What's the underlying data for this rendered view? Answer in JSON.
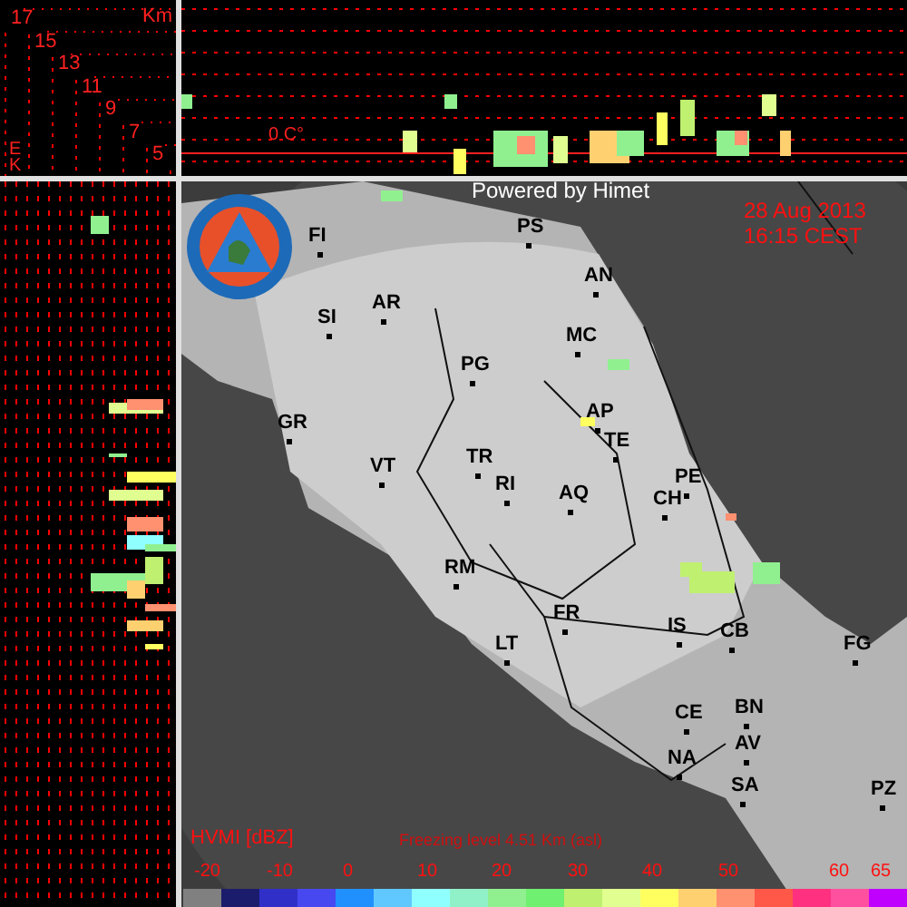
{
  "altitude_axis": {
    "unit": "Km",
    "labels": [
      "17",
      "15",
      "13",
      "11",
      "9",
      "7",
      "5"
    ],
    "corner_letters": [
      "E",
      "K"
    ]
  },
  "vertical_section": {
    "freezing_marker": "0 C°"
  },
  "map": {
    "credit": "Powered by Himet",
    "date": "28 Aug 2013",
    "time": "16:15 CEST",
    "cities": [
      "FI",
      "PS",
      "AN",
      "SI",
      "AR",
      "MC",
      "PG",
      "AP",
      "GR",
      "TE",
      "TR",
      "VT",
      "RI",
      "PE",
      "AQ",
      "CH",
      "RM",
      "FR",
      "IS",
      "CB",
      "LT",
      "FG",
      "CE",
      "BN",
      "AV",
      "NA",
      "SA",
      "PZ"
    ]
  },
  "legend": {
    "title": "HVMI [dBZ]",
    "freezing_level": "Freezing level  4.51 Km (asl)",
    "ticks": [
      "-20",
      "-10",
      "0",
      "10",
      "20",
      "30",
      "40",
      "50",
      "60",
      "65"
    ],
    "color_scale": [
      {
        "color": "#808080"
      },
      {
        "color": "#1c1c6c"
      },
      {
        "color": "#3030c8"
      },
      {
        "color": "#4848f0"
      },
      {
        "color": "#2090ff"
      },
      {
        "color": "#60c8ff"
      },
      {
        "color": "#90ffff"
      },
      {
        "color": "#90f0c8"
      },
      {
        "color": "#90f090"
      },
      {
        "color": "#70f070"
      },
      {
        "color": "#c0f070"
      },
      {
        "color": "#e0ff90"
      },
      {
        "color": "#ffff60"
      },
      {
        "color": "#ffd070"
      },
      {
        "color": "#ff9070"
      },
      {
        "color": "#ff5848"
      },
      {
        "color": "#ff3080"
      },
      {
        "color": "#ff50a0"
      },
      {
        "color": "#c000ff"
      }
    ]
  }
}
